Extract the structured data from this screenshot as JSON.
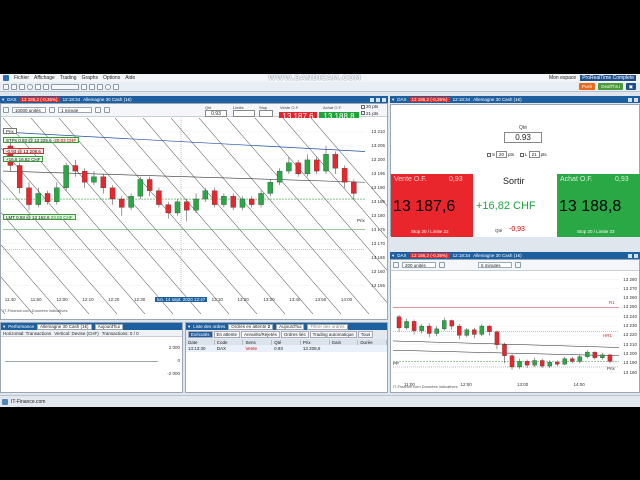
{
  "app": {
    "menu": [
      "Fichier",
      "Affichage",
      "Trading",
      "Graphs",
      "Options",
      "Aide"
    ],
    "right_menu": [
      "Mon espace"
    ],
    "brand": "ProRealTime Complete",
    "toolbar_buttons": [
      "Push",
      "DealThru"
    ],
    "recorder_watermark": "WWW.BANDICAM.COM",
    "colors": {
      "window_title": "#1e5fa0",
      "sell": "#e0272f",
      "buy": "#1fa43c",
      "up_candle": "#2aa845",
      "down_candle": "#e8262c"
    }
  },
  "main_chart": {
    "title": "DAX",
    "price_badge": "13 186,2 (-0,35%)",
    "time": "12:18:34",
    "instrument": "Allemagne 30 Cash (1€)",
    "units": "10000 unités",
    "period": "1 minute",
    "qty_label": "Qté",
    "qty": "0.93",
    "limit_label": "Limite",
    "stop_label": "Stop",
    "sell_label": "Vente O.F.",
    "sell_price": "13 187,6",
    "buy_label": "Achat O.F.",
    "buy_price": "13 188,8",
    "stop_pts": "20 pts",
    "limit_pts": "21 pts",
    "tags": {
      "prix": "Prix",
      "stp": "STPs 0.93 @ 13 225,6",
      "stp_pnl": "-20,03 CHF",
      "position": "-0.93 @ 13 208,6",
      "pnl": "+16,8",
      "pnl_chf": "16,82 CHF",
      "lmt": "LMT 0.93 @ 13 162,6",
      "lmt_pnl": "23,03 CHF",
      "prix_right": "Prix"
    },
    "source": "IT-Finance.com Données indicatives",
    "cursor_time": "lun. 14 sept. 2020 12:47",
    "chart_data": {
      "type": "candlestick",
      "title": "DAX",
      "subtitle": "Allemagne 30 Cash (1€)",
      "xlabel": "",
      "ylabel": "",
      "x_ticks": [
        "11:40",
        "11:50",
        "12:00",
        "12:10",
        "12:20",
        "12:30",
        "12:47",
        "13:00",
        "13:10",
        "13:20",
        "13:30",
        "13:40",
        "13:50",
        "14:00"
      ],
      "y_ticks": [
        "13 210",
        "13 205",
        "13 200",
        "13 195",
        "13 190",
        "13 185",
        "13 180",
        "13 175",
        "13 170",
        "13 165",
        "13 160",
        "13 155"
      ],
      "ylim": [
        13152,
        13215
      ],
      "candles": [
        {
          "o": 13205,
          "c": 13198,
          "h": 13207,
          "l": 13196
        },
        {
          "o": 13198,
          "c": 13190,
          "h": 13199,
          "l": 13188
        },
        {
          "o": 13190,
          "c": 13184,
          "h": 13192,
          "l": 13182
        },
        {
          "o": 13184,
          "c": 13188,
          "h": 13190,
          "l": 13183
        },
        {
          "o": 13188,
          "c": 13185,
          "h": 13189,
          "l": 13184
        },
        {
          "o": 13185,
          "c": 13190,
          "h": 13192,
          "l": 13184
        },
        {
          "o": 13190,
          "c": 13198,
          "h": 13199,
          "l": 13189
        },
        {
          "o": 13198,
          "c": 13196,
          "h": 13200,
          "l": 13194
        },
        {
          "o": 13196,
          "c": 13192,
          "h": 13197,
          "l": 13190
        },
        {
          "o": 13192,
          "c": 13194,
          "h": 13196,
          "l": 13191
        },
        {
          "o": 13194,
          "c": 13190,
          "h": 13195,
          "l": 13188
        },
        {
          "o": 13190,
          "c": 13186,
          "h": 13191,
          "l": 13184
        },
        {
          "o": 13186,
          "c": 13183,
          "h": 13187,
          "l": 13180
        },
        {
          "o": 13183,
          "c": 13187,
          "h": 13188,
          "l": 13182
        },
        {
          "o": 13187,
          "c": 13193,
          "h": 13194,
          "l": 13186
        },
        {
          "o": 13193,
          "c": 13189,
          "h": 13194,
          "l": 13187
        },
        {
          "o": 13189,
          "c": 13184,
          "h": 13190,
          "l": 13183
        },
        {
          "o": 13184,
          "c": 13181,
          "h": 13185,
          "l": 13179
        },
        {
          "o": 13181,
          "c": 13185,
          "h": 13186,
          "l": 13180
        },
        {
          "o": 13185,
          "c": 13182,
          "h": 13186,
          "l": 13178
        },
        {
          "o": 13182,
          "c": 13186,
          "h": 13188,
          "l": 13181
        },
        {
          "o": 13186,
          "c": 13189,
          "h": 13190,
          "l": 13185
        },
        {
          "o": 13189,
          "c": 13184,
          "h": 13190,
          "l": 13183
        },
        {
          "o": 13184,
          "c": 13187,
          "h": 13188,
          "l": 13183
        },
        {
          "o": 13187,
          "c": 13183,
          "h": 13188,
          "l": 13182
        },
        {
          "o": 13183,
          "c": 13186,
          "h": 13187,
          "l": 13182
        },
        {
          "o": 13186,
          "c": 13184,
          "h": 13187,
          "l": 13183
        },
        {
          "o": 13184,
          "c": 13188,
          "h": 13189,
          "l": 13183
        },
        {
          "o": 13188,
          "c": 13192,
          "h": 13193,
          "l": 13187
        },
        {
          "o": 13192,
          "c": 13196,
          "h": 13197,
          "l": 13191
        },
        {
          "o": 13196,
          "c": 13199,
          "h": 13201,
          "l": 13195
        },
        {
          "o": 13199,
          "c": 13195,
          "h": 13200,
          "l": 13194
        },
        {
          "o": 13195,
          "c": 13200,
          "h": 13202,
          "l": 13194
        },
        {
          "o": 13200,
          "c": 13196,
          "h": 13201,
          "l": 13195
        },
        {
          "o": 13196,
          "c": 13202,
          "h": 13205,
          "l": 13195
        },
        {
          "o": 13202,
          "c": 13197,
          "h": 13203,
          "l": 13195
        },
        {
          "o": 13197,
          "c": 13192,
          "h": 13198,
          "l": 13190
        },
        {
          "o": 13192,
          "c": 13188,
          "h": 13193,
          "l": 13186
        }
      ]
    }
  },
  "order_panel": {
    "title": "DAX",
    "price_badge": "13 186,2 (-0,35%)",
    "time": "12:18:34",
    "instrument": "Allemagne 30 Cash (1€)",
    "qty_label": "Qté",
    "qty": "0.93",
    "stop_label": "S",
    "stop_pts": "20",
    "pts": "pts",
    "limit_label": "L",
    "limit_pts": "21",
    "sell_label": "Vente O.F.",
    "sell_qty": "0,93",
    "sell_price": "13 187,6",
    "sell_sub": "Stop 20 / Limite 23",
    "mid_label": "Sortir",
    "mid_pnl": "+16,82 CHF",
    "mid_qty_label": "Qté",
    "mid_qty": "-0,93",
    "buy_label": "Achat O.F.",
    "buy_qty": "0,93",
    "buy_price": "13 188,8",
    "buy_sub": "Stop 20 / Limite 23"
  },
  "small_chart": {
    "title": "DAX",
    "price_badge": "13 186,2 (-0,35%)",
    "time": "12:18:34",
    "instrument": "Allemagne 30 Cash (1€)",
    "units": "200 unités",
    "period": "5 minutes",
    "source": "IT-Finance.com Données indicatives",
    "labels": {
      "r1": "R1",
      "hr1": "HR1",
      "pivot": "PP",
      "prix": "Prix"
    },
    "chart_data": {
      "type": "candlestick",
      "title": "DAX",
      "xlabel": "",
      "ylabel": "",
      "x_ticks": [
        "11:00",
        "12:00",
        "13:00",
        "14:00"
      ],
      "y_ticks": [
        "13 280",
        "13 270",
        "13 260",
        "13 250",
        "13 240",
        "13 230",
        "13 220",
        "13 210",
        "13 200",
        "13 190",
        "13 180"
      ],
      "ylim": [
        13172,
        13286
      ],
      "candles": [
        {
          "o": 13240,
          "c": 13228,
          "h": 13242,
          "l": 13224
        },
        {
          "o": 13228,
          "c": 13235,
          "h": 13238,
          "l": 13226
        },
        {
          "o": 13235,
          "c": 13225,
          "h": 13237,
          "l": 13221
        },
        {
          "o": 13225,
          "c": 13230,
          "h": 13232,
          "l": 13222
        },
        {
          "o": 13230,
          "c": 13222,
          "h": 13233,
          "l": 13218
        },
        {
          "o": 13222,
          "c": 13227,
          "h": 13230,
          "l": 13219
        },
        {
          "o": 13227,
          "c": 13236,
          "h": 13239,
          "l": 13225
        },
        {
          "o": 13236,
          "c": 13230,
          "h": 13237,
          "l": 13226
        },
        {
          "o": 13230,
          "c": 13220,
          "h": 13232,
          "l": 13216
        },
        {
          "o": 13220,
          "c": 13226,
          "h": 13228,
          "l": 13218
        },
        {
          "o": 13226,
          "c": 13221,
          "h": 13228,
          "l": 13217
        },
        {
          "o": 13221,
          "c": 13230,
          "h": 13232,
          "l": 13219
        },
        {
          "o": 13230,
          "c": 13224,
          "h": 13231,
          "l": 13220
        },
        {
          "o": 13224,
          "c": 13210,
          "h": 13225,
          "l": 13205
        },
        {
          "o": 13210,
          "c": 13198,
          "h": 13212,
          "l": 13190
        },
        {
          "o": 13198,
          "c": 13186,
          "h": 13200,
          "l": 13183
        },
        {
          "o": 13186,
          "c": 13192,
          "h": 13195,
          "l": 13184
        },
        {
          "o": 13192,
          "c": 13188,
          "h": 13194,
          "l": 13185
        },
        {
          "o": 13188,
          "c": 13193,
          "h": 13196,
          "l": 13186
        },
        {
          "o": 13193,
          "c": 13187,
          "h": 13195,
          "l": 13185
        },
        {
          "o": 13187,
          "c": 13191,
          "h": 13193,
          "l": 13185
        },
        {
          "o": 13191,
          "c": 13189,
          "h": 13193,
          "l": 13187
        },
        {
          "o": 13189,
          "c": 13195,
          "h": 13197,
          "l": 13188
        },
        {
          "o": 13195,
          "c": 13192,
          "h": 13197,
          "l": 13190
        },
        {
          "o": 13192,
          "c": 13197,
          "h": 13199,
          "l": 13190
        },
        {
          "o": 13197,
          "c": 13202,
          "h": 13204,
          "l": 13195
        },
        {
          "o": 13202,
          "c": 13196,
          "h": 13203,
          "l": 13194
        },
        {
          "o": 13196,
          "c": 13199,
          "h": 13201,
          "l": 13194
        },
        {
          "o": 13199,
          "c": 13192,
          "h": 13200,
          "l": 13190
        }
      ]
    }
  },
  "perf_panel": {
    "title": "Performance",
    "instrument": "Allemagne 30 Cash (1€)",
    "period": "Aujourd'hui",
    "horizontal": "Horizontal: Transactions",
    "vertical": "Vertical: Devise (CHF)",
    "transactions": "Transactions: 0 / 0",
    "y_values": [
      "2 000",
      "0",
      "-2 000"
    ]
  },
  "orders_panel": {
    "title": "Liste des ordres",
    "filter": "Ordres en attente",
    "count": "2",
    "period": "Aujourd'hui",
    "search_placeholder": "Filtrer des ordres",
    "tabs": [
      "Exécutés",
      "En attente",
      "Annulés/Rejetés",
      "Ordres liés",
      "Trading automatique",
      "Tous"
    ],
    "columns": [
      "Date",
      "Code",
      "Sens",
      "Qté",
      "Prix",
      "Gain",
      "Durée"
    ],
    "rows": [
      [
        "13:13:30",
        "DAX",
        "Vente",
        "0.93",
        "13 208,6",
        "",
        ""
      ]
    ]
  },
  "status": {
    "source": "IT-Finance.com"
  }
}
